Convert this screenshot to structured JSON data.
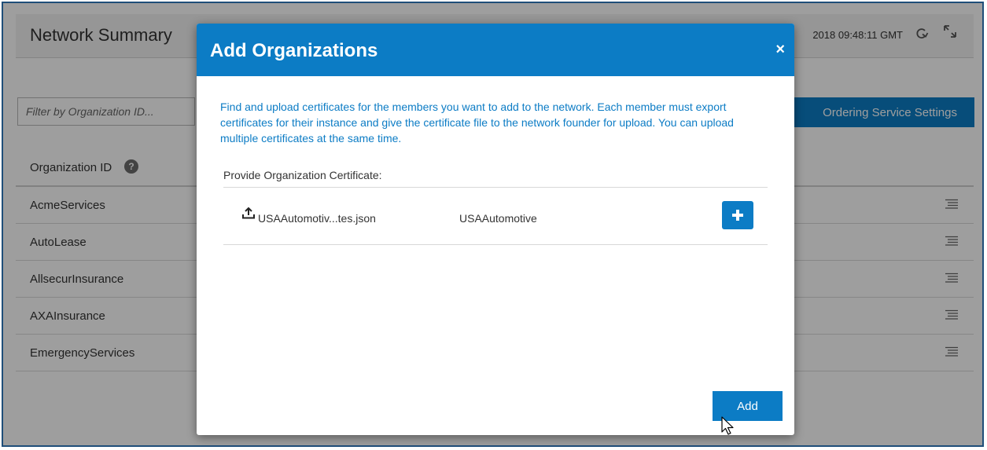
{
  "page": {
    "title": "Network Summary",
    "time": "2018 09:48:11 GMT",
    "icons": {
      "refresh": "refresh-icon",
      "expand": "expand-icon",
      "row_menu": "list-menu-icon"
    }
  },
  "filter": {
    "placeholder": "Filter by Organization ID..."
  },
  "ordering_button": "Ordering Service Settings",
  "table": {
    "column_header": "Organization ID",
    "help_glyph": "?",
    "rows": [
      "AcmeServices",
      "AutoLease",
      "AllsecurInsurance",
      "AXAInsurance",
      "EmergencyServices"
    ]
  },
  "modal": {
    "title": "Add Organizations",
    "close_glyph": "×",
    "description": "Find and upload certificates for the members you want to add to the network. Each member must export certificates for their instance and give the certificate file to the network founder for upload. You can upload multiple certificates at the same time.",
    "cert_label": "Provide Organization Certificate:",
    "file_name": "USAAutomotiv...tes.json",
    "org_name": "USAAutomotive",
    "add_label": "Add"
  },
  "colors": {
    "primary": "#0c7cc5",
    "frame": "#1f4e79"
  }
}
